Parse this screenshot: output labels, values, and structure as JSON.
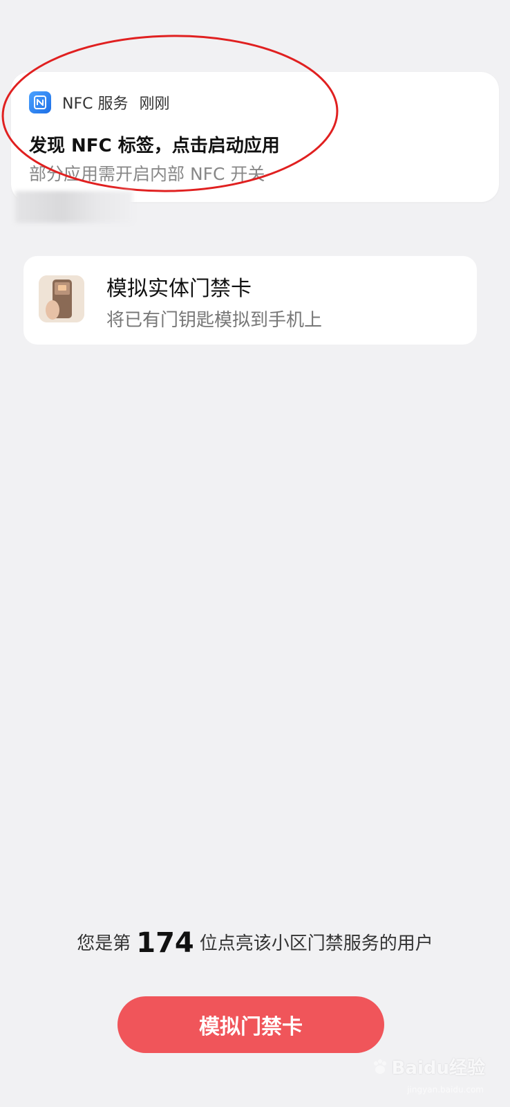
{
  "notification": {
    "app_name": "NFC 服务",
    "time": "刚刚",
    "title": "发现 NFC 标签，点击启动应用",
    "subtitle": "部分应用需开启内部 NFC 开关"
  },
  "sim_card": {
    "title": "模拟实体门禁卡",
    "subtitle": "将已有门钥匙模拟到手机上"
  },
  "footer": {
    "prefix": "您是第",
    "count": "174",
    "suffix": "位点亮该小区门禁服务的用户",
    "button_label": "模拟门禁卡"
  },
  "watermark": {
    "text": "Baidu经验",
    "url": "jingyan.baidu.com"
  },
  "colors": {
    "accent": "#f0555a",
    "annotation": "#e02020",
    "background": "#f1f1f3"
  },
  "icons": {
    "nfc": "nfc-icon",
    "card_thumb": "phone-card-thumbnail"
  }
}
